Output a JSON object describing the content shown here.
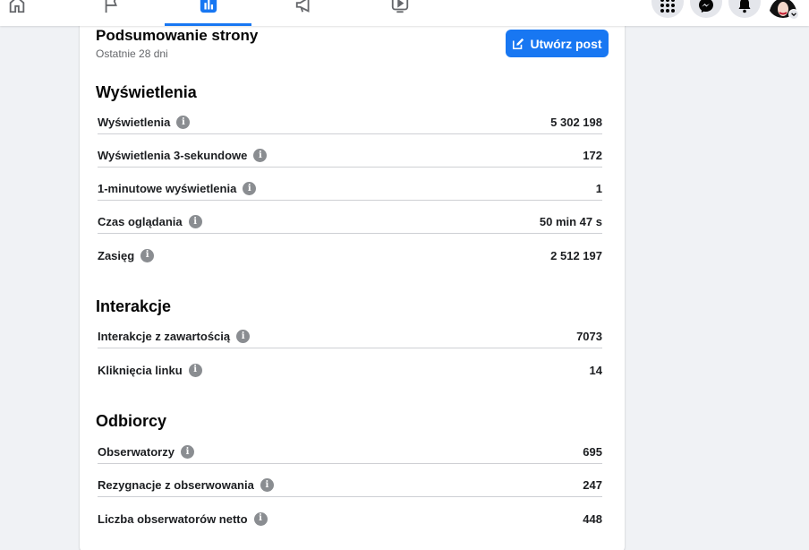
{
  "summary": {
    "title": "Podsumowanie strony",
    "subtitle": "Ostatnie 28 dni",
    "create_button_label": "Utwórz post"
  },
  "sections": {
    "views": {
      "title": "Wyświetlenia",
      "rows": [
        {
          "label": "Wyświetlenia",
          "value": "5 302 198"
        },
        {
          "label": "Wyświetlenia 3-sekundowe",
          "value": "172"
        },
        {
          "label": "1-minutowe wyświetlenia",
          "value": "1"
        },
        {
          "label": "Czas oglądania",
          "value": "50 min 47 s"
        },
        {
          "label": "Zasięg",
          "value": "2 512 197"
        }
      ]
    },
    "interactions": {
      "title": "Interakcje",
      "rows": [
        {
          "label": "Interakcje z zawartością",
          "value": "7073"
        },
        {
          "label": "Kliknięcia linku",
          "value": "14"
        }
      ]
    },
    "audience": {
      "title": "Odbiorcy",
      "rows": [
        {
          "label": "Obserwatorzy",
          "value": "695"
        },
        {
          "label": "Rezygnacje z obserwowania",
          "value": "247"
        },
        {
          "label": "Liczba obserwatorów netto",
          "value": "448"
        }
      ]
    }
  },
  "icons": {
    "info": "i"
  },
  "colors": {
    "accent": "#1877f2",
    "background": "#f0f2f5",
    "divider": "#ced0d4",
    "info_icon": "#8a8d91"
  }
}
